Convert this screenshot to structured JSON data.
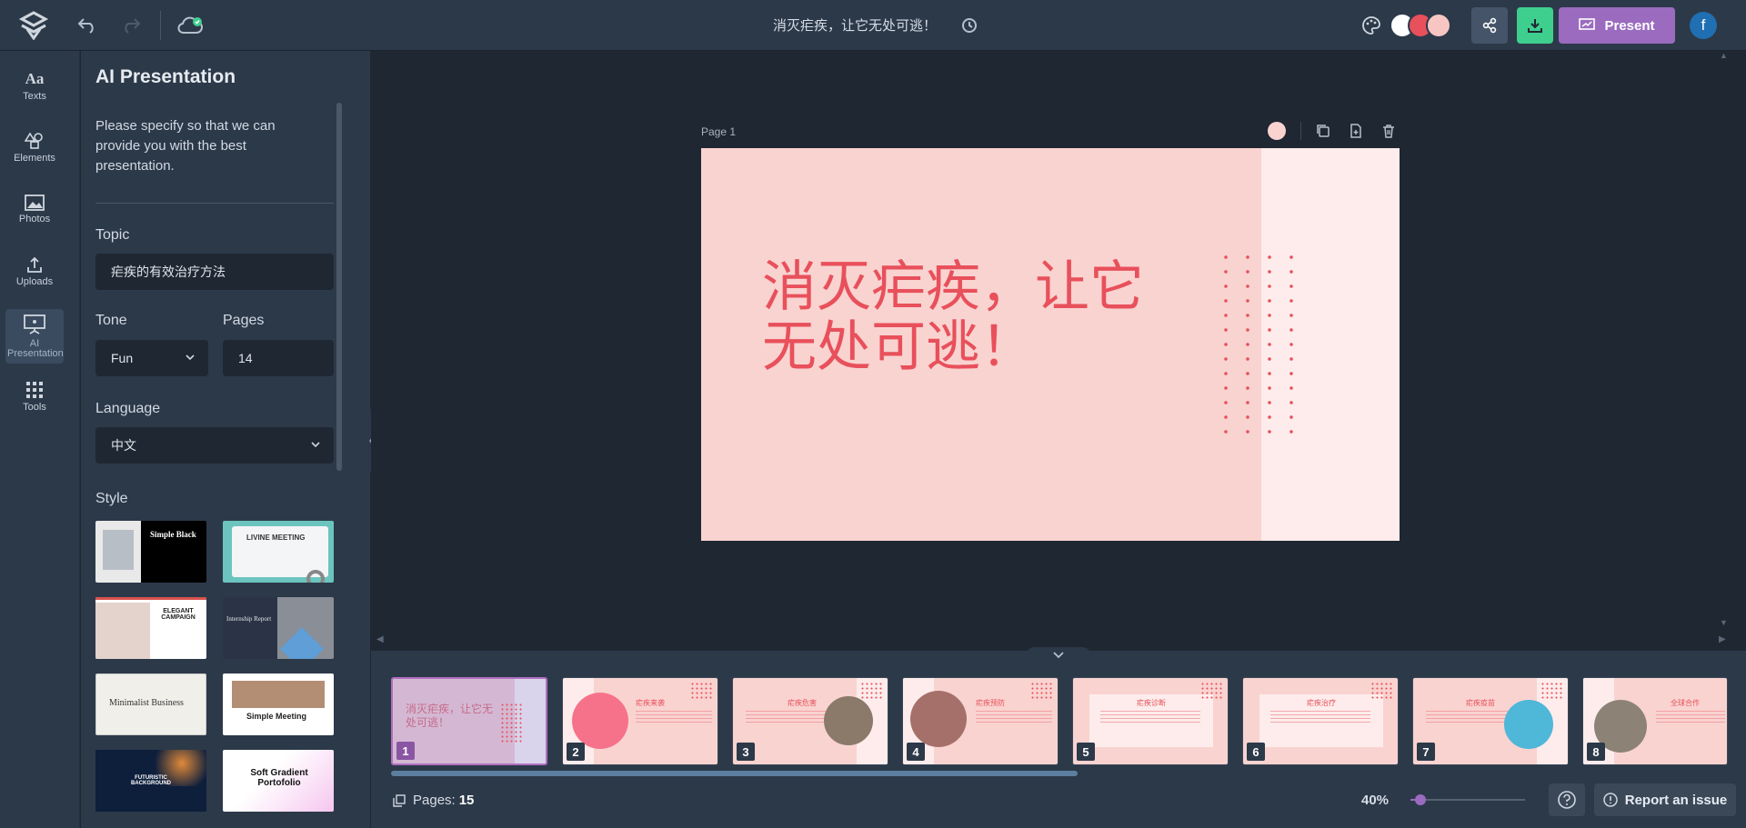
{
  "topbar": {
    "doc_title": "消灭疟疾，让它无处可逃！",
    "present_label": "Present",
    "avatar_initial": "f",
    "swatches": [
      "#ffffff",
      "#e8505b",
      "#f7c6c2"
    ]
  },
  "rail": {
    "items": [
      {
        "label": "Texts",
        "icon": "text-aa-icon"
      },
      {
        "label": "Elements",
        "icon": "shapes-icon"
      },
      {
        "label": "Photos",
        "icon": "image-icon"
      },
      {
        "label": "Uploads",
        "icon": "upload-icon"
      },
      {
        "label": "AI Presentation",
        "icon": "presentation-board-icon"
      },
      {
        "label": "Tools",
        "icon": "grid-icon"
      }
    ]
  },
  "panel": {
    "title": "AI Presentation",
    "description": "Please specify so that we can provide you with the best presentation.",
    "topic_label": "Topic",
    "topic_value": "疟疾的有效治疗方法",
    "tone_label": "Tone",
    "tone_value": "Fun",
    "pages_label": "Pages",
    "pages_value": "14",
    "language_label": "Language",
    "language_value": "中文",
    "style_label": "Style",
    "styles": [
      {
        "name": "Simple Black"
      },
      {
        "name": "LIVINE MEETING"
      },
      {
        "name": "ELEGANT CAMPAIGN"
      },
      {
        "name": "Internship Report"
      },
      {
        "name": "Minimalist Business"
      },
      {
        "name": "Simple Meeting"
      },
      {
        "name": "FUTURISTIC BACKGROUND"
      },
      {
        "name": "Soft Gradient Portofolio"
      }
    ]
  },
  "canvas": {
    "page_label": "Page 1",
    "slide_title": "消灭疟疾，让它无处可逃！",
    "slide_bg": "#f9d3d0",
    "accent": "#e8505b"
  },
  "thumbnails": [
    {
      "num": "1",
      "head": "消灭疟疾，让它无处可逃！"
    },
    {
      "num": "2",
      "head": "疟疾来袭"
    },
    {
      "num": "3",
      "head": "疟疾危害"
    },
    {
      "num": "4",
      "head": "疟疾预防"
    },
    {
      "num": "5",
      "head": "疟疾诊断"
    },
    {
      "num": "6",
      "head": "疟疾治疗"
    },
    {
      "num": "7",
      "head": "疟疾疫苗"
    },
    {
      "num": "8",
      "head": "全球合作"
    }
  ],
  "footer": {
    "pages_prefix": "Pages:",
    "pages_total": "15",
    "zoom_label": "40%",
    "zoom_fraction": 0.4,
    "report_label": "Report an issue"
  }
}
